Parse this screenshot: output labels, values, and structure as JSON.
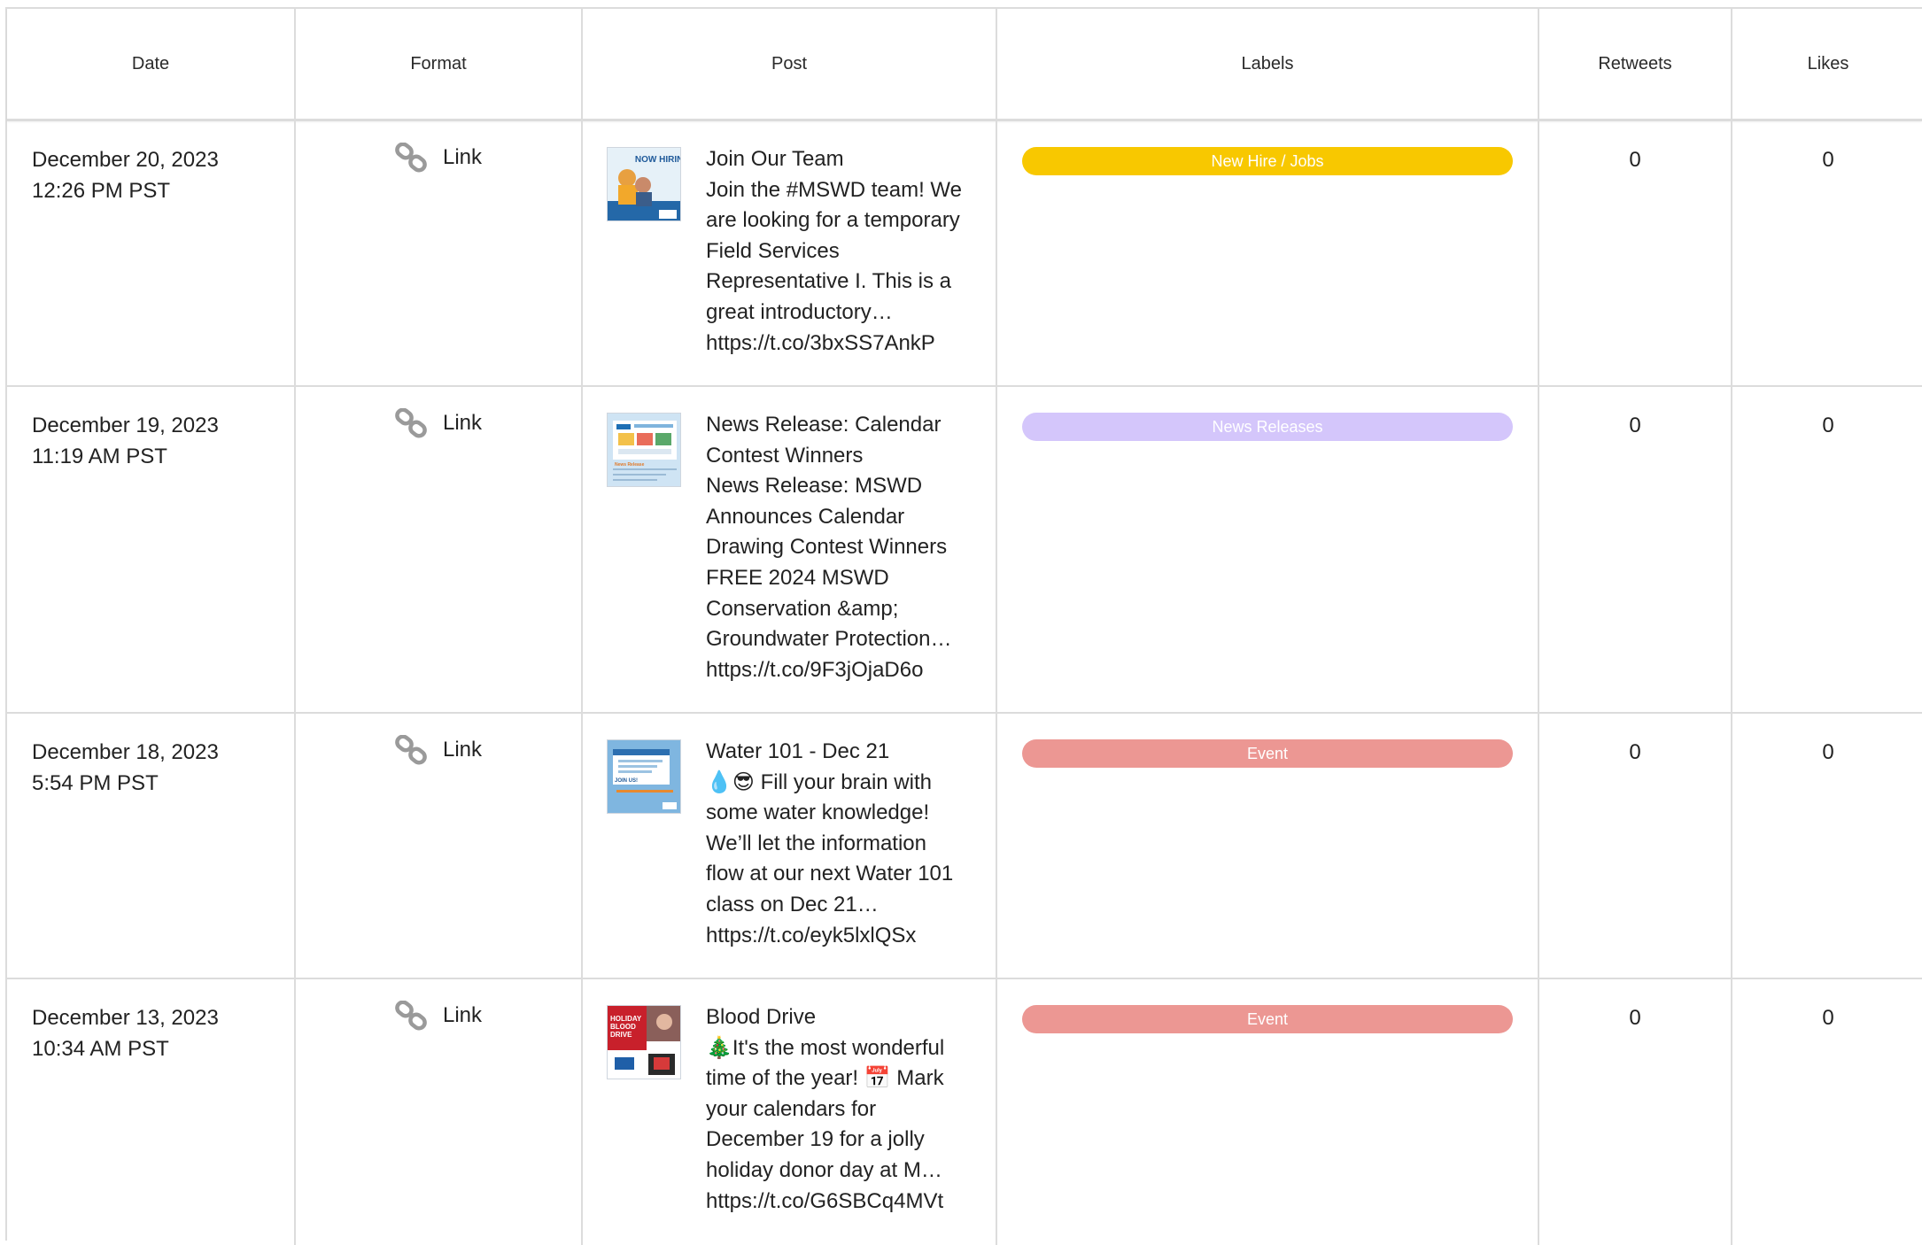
{
  "columns": {
    "date": "Date",
    "format": "Format",
    "post": "Post",
    "labels": "Labels",
    "retweets": "Retweets",
    "likes": "Likes"
  },
  "rows": [
    {
      "date": "December 20, 2023",
      "time": "12:26 PM PST",
      "format": "Link",
      "post_lines": [
        "Join Our Team",
        "Join the #MSWD team! We",
        "are looking for a temporary",
        "Field Services",
        "Representative I. This is a",
        "great introductory…",
        "https://t.co/3bxSS7AnkP"
      ],
      "thumb_text": "NOW HIRING",
      "label": "New Hire / Jobs",
      "label_color": "#f8c800",
      "retweets": "0",
      "likes": "0"
    },
    {
      "date": "December 19, 2023",
      "time": "11:19 AM PST",
      "format": "Link",
      "post_lines": [
        "News Release: Calendar",
        "Contest Winners",
        "News Release: MSWD",
        "Announces Calendar",
        "Drawing Contest Winners",
        "FREE 2024 MSWD",
        "Conservation &amp;",
        "Groundwater Protection…",
        "https://t.co/9F3jOjaD6o"
      ],
      "thumb_text": "News Release",
      "label": "News Releases",
      "label_color": "#d4c6fb",
      "retweets": "0",
      "likes": "0"
    },
    {
      "date": "December 18, 2023",
      "time": "5:54 PM PST",
      "format": "Link",
      "post_lines": [
        "Water 101 - Dec 21",
        "💧😎 Fill your brain with",
        "some water knowledge!",
        "We’ll let the information",
        "flow at our next Water 101",
        "class on Dec 21…",
        "https://t.co/eyk5lxlQSx"
      ],
      "thumb_text": "JOIN US!",
      "label": "Event",
      "label_color": "#ec9793",
      "retweets": "0",
      "likes": "0"
    },
    {
      "date": "December 13, 2023",
      "time": "10:34 AM PST",
      "format": "Link",
      "post_lines": [
        "Blood Drive",
        "🎄It's the most wonderful",
        "time of the year! 📅 Mark",
        "your calendars for",
        "December 19 for a jolly",
        "holiday donor day at M…",
        "https://t.co/G6SBCq4MVt"
      ],
      "thumb_text": "HOLIDAY BLOOD DRIVE",
      "label": "Event",
      "label_color": "#ec9793",
      "retweets": "0",
      "likes": "0"
    }
  ]
}
